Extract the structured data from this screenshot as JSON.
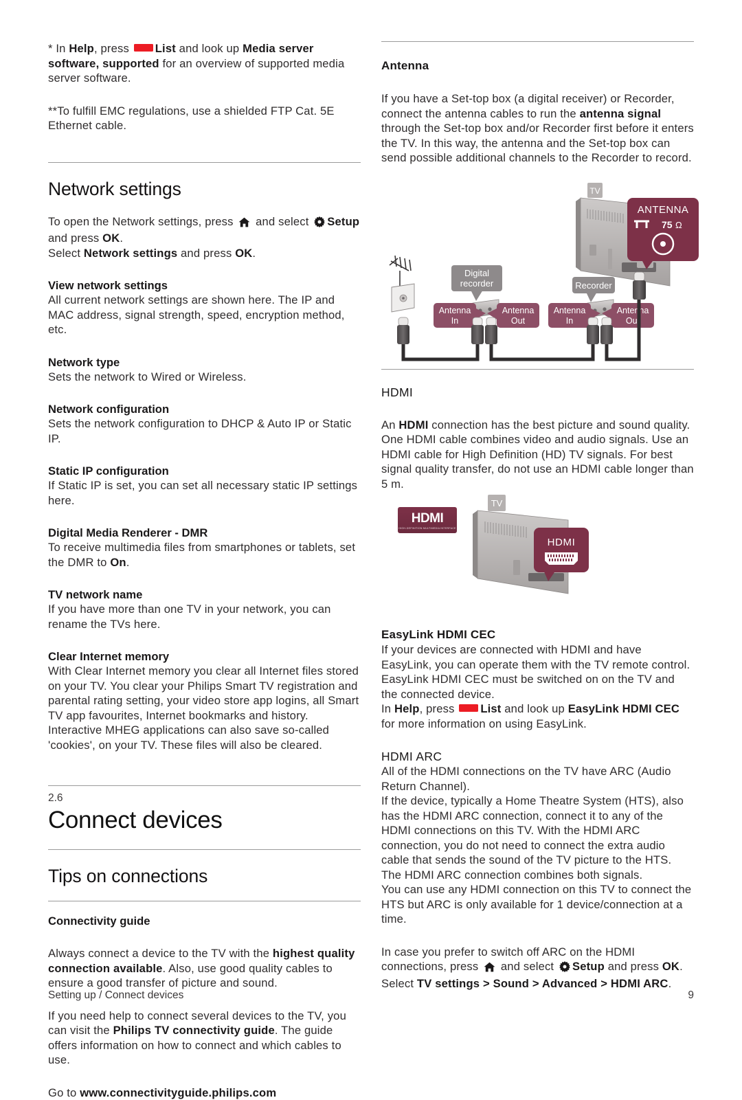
{
  "footer": {
    "breadcrumb": "Setting up / Connect devices",
    "page_number": "9"
  },
  "colors": {
    "key_red": "#ec1c24",
    "badge_maroon": "#8d4f66",
    "badge_dark_maroon": "#7d3148",
    "badge_grey": "#8e8a8b",
    "device_grey": "#b8b5b4",
    "rule_grey": "#9a9a9a"
  },
  "left_column": {
    "footnote1": {
      "prefix": "* In ",
      "help": "Help",
      "press": ", press ",
      "list": "List",
      "mid": " and look up ",
      "topic": "Media server software, supported",
      "suffix": " for an overview of supported media server software."
    },
    "footnote2": "**To fulfill EMC regulations, use a shielded FTP Cat. 5E Ethernet cable.",
    "section_title": "Network settings",
    "intro": {
      "line1_a": "To open the Network settings, press ",
      "line1_b": " and select ",
      "setup": "Setup",
      "line1_c": " and press ",
      "ok1": "OK",
      "line1_d": ".",
      "line2_a": "Select ",
      "line2_b": "Network settings",
      "line2_c": " and press ",
      "ok2": "OK",
      "line2_d": "."
    },
    "topics": [
      {
        "heading": "View network settings",
        "body": "All current network settings are shown here. The IP and MAC address, signal strength, speed, encryption method, etc."
      },
      {
        "heading": "Network type",
        "body": "Sets the network to Wired or Wireless."
      },
      {
        "heading": "Network configuration",
        "body": "Sets the network configuration to DHCP & Auto IP or Static IP."
      },
      {
        "heading": "Static IP configuration",
        "body": "If Static IP is set, you can set all necessary static IP settings here."
      },
      {
        "heading": "Digital Media Renderer - DMR",
        "body_a": "To receive multimedia files from smartphones or tablets, set the DMR to ",
        "body_bold": "On",
        "body_b": "."
      },
      {
        "heading": "TV network name",
        "body": "If you have more than one TV in your network, you can rename the TVs here."
      },
      {
        "heading": "Clear Internet memory",
        "body": "With Clear Internet memory you clear all Internet files stored on your TV. You clear your Philips Smart TV registration and parental rating setting, your video store app logins, all Smart TV app favourites, Internet bookmarks and history. Interactive MHEG applications can also save so-called 'cookies', on your TV. These files will also be cleared."
      }
    ],
    "chapter_number": "2.6",
    "chapter_title": "Connect devices",
    "tips_title": "Tips on connections",
    "connectivity_guide_heading": "Connectivity guide",
    "connectivity": {
      "p1_a": "Always connect a device to the TV with the ",
      "p1_bold": "highest quality connection available",
      "p1_b": ". Also, use good quality cables to ensure a good transfer of picture and sound.",
      "p2_a": "If you need help to connect several devices to the TV, you can visit the ",
      "p2_bold": "Philips TV connectivity guide",
      "p2_b": ". The guide offers information on how to connect and which cables to use.",
      "p3_a": "Go to ",
      "p3_bold": "www.connectivityguide.philips.com"
    }
  },
  "right_column": {
    "antenna_heading": "Antenna",
    "antenna_body": {
      "a": "If you have a Set-top box (a digital receiver) or Recorder, connect the antenna cables to run the ",
      "bold": "antenna signal",
      "b": " through the Set-top box and/or Recorder first before it enters the TV. In this way, the antenna and the Set-top box can send possible additional channels to the Recorder to record."
    },
    "antenna_diagram": {
      "tv_label": "TV",
      "antenna_badge_title": "ANTENNA",
      "antenna_badge_impedance": "75",
      "antenna_badge_ohm": "Ω",
      "digital_recorder_label_line1": "Digital",
      "digital_recorder_label_line2": "recorder",
      "recorder_label": "Recorder",
      "port_labels": [
        {
          "line1": "Antenna",
          "line2": "In"
        },
        {
          "line1": "Antenna",
          "line2": "Out"
        },
        {
          "line1": "Antenna",
          "line2": "In"
        },
        {
          "line1": "Antenna",
          "line2": "Out"
        }
      ]
    },
    "hdmi_heading": "HDMI",
    "hdmi_body": "An HDMI connection has the best picture and sound quality. One HDMI cable combines video and audio signals. Use an HDMI cable for High Definition (HD) TV signals. For best signal quality transfer, do not use an HDMI cable longer than 5 m.",
    "hdmi_body_bold": "HDMI",
    "hdmi_diagram": {
      "logo_wordmark": "HDMI",
      "logo_tagline": "HIGH-DEFINITION MULTIMEDIA INTERFACE",
      "tv_label": "TV",
      "port_badge_label": "HDMI"
    },
    "easylink_heading": "EasyLink HDMI CEC",
    "easylink_body": "If your devices are connected with HDMI and have EasyLink, you can operate them with the TV remote control. EasyLink HDMI CEC must be switched on on the TV and the connected device.",
    "easylink_help": {
      "a": "In ",
      "help": "Help",
      "b": ", press ",
      "list": "List",
      "c": " and look up ",
      "topic": "EasyLink HDMI CEC",
      "d": " for more information on using EasyLink."
    },
    "arc_heading": "HDMI ARC",
    "arc_body1": "All of the HDMI connections on the TV have ARC (Audio Return Channel).",
    "arc_body2": "If the device, typically a Home Theatre System (HTS), also has the HDMI ARC connection, connect it to any of the HDMI connections on this TV. With the HDMI ARC connection, you do not need to connect the extra audio cable that sends the sound of the TV picture to the HTS. The HDMI ARC connection combines both signals.",
    "arc_body3": "You can use any HDMI connection on this TV to connect the HTS but ARC is only available for 1 device/connection at a time.",
    "arc_switch_off": {
      "a": "In case you prefer to switch off ARC on the HDMI connections, press ",
      "b": " and select ",
      "setup": "Setup",
      "c": " and press ",
      "ok": "OK",
      "d": ".",
      "select_a": "Select ",
      "tv_settings": "TV settings",
      "gt1": " > ",
      "sound": "Sound",
      "gt2": " > ",
      "advanced": "Advanced",
      "gt3": " > ",
      "hdmi_arc": "HDMI ARC",
      "period": "."
    }
  }
}
